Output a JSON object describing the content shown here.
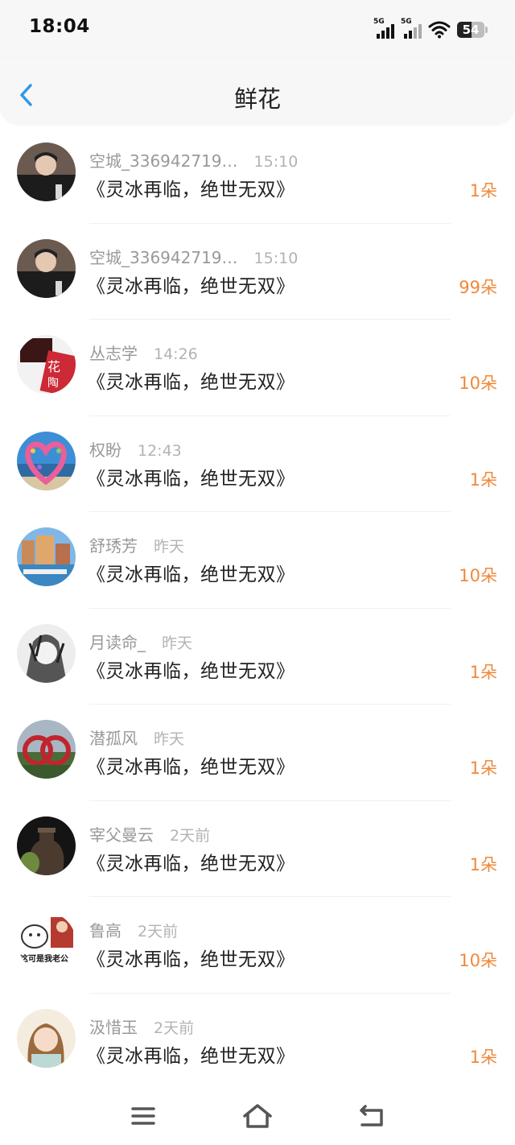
{
  "status": {
    "time": "18:04",
    "signal1": "5G",
    "signal2": "5G",
    "battery": "54",
    "battery_level": 0.54
  },
  "header": {
    "title": "鲜花"
  },
  "icons": {
    "back": "chevron-left-icon",
    "menu": "menu-icon",
    "home": "home-icon",
    "return": "return-icon"
  },
  "colors": {
    "accent": "#2f97e8",
    "count": "#f0883a",
    "name": "#999999"
  },
  "items": [
    {
      "name": "空城_336942719…",
      "time": "15:10",
      "title": "《灵冰再临，绝世无双》",
      "count": "1朵"
    },
    {
      "name": "空城_336942719…",
      "time": "15:10",
      "title": "《灵冰再临，绝世无双》",
      "count": "99朵"
    },
    {
      "name": "丛志学",
      "time": "14:26",
      "title": "《灵冰再临，绝世无双》",
      "count": "10朵"
    },
    {
      "name": "权盼",
      "time": "12:43",
      "title": "《灵冰再临，绝世无双》",
      "count": "1朵"
    },
    {
      "name": "舒琇芳",
      "time": "昨天",
      "title": "《灵冰再临，绝世无双》",
      "count": "10朵"
    },
    {
      "name": "月读命_",
      "time": "昨天",
      "title": "《灵冰再临，绝世无双》",
      "count": "1朵"
    },
    {
      "name": "潜孤风",
      "time": "昨天",
      "title": "《灵冰再临，绝世无双》",
      "count": "1朵"
    },
    {
      "name": "宰父曼云",
      "time": "2天前",
      "title": "《灵冰再临，绝世无双》",
      "count": "1朵"
    },
    {
      "name": "鲁高",
      "time": "2天前",
      "title": "《灵冰再临，绝世无双》",
      "count": "10朵"
    },
    {
      "name": "汲惜玉",
      "time": "2天前",
      "title": "《灵冰再临，绝世无双》",
      "count": "1朵"
    }
  ]
}
